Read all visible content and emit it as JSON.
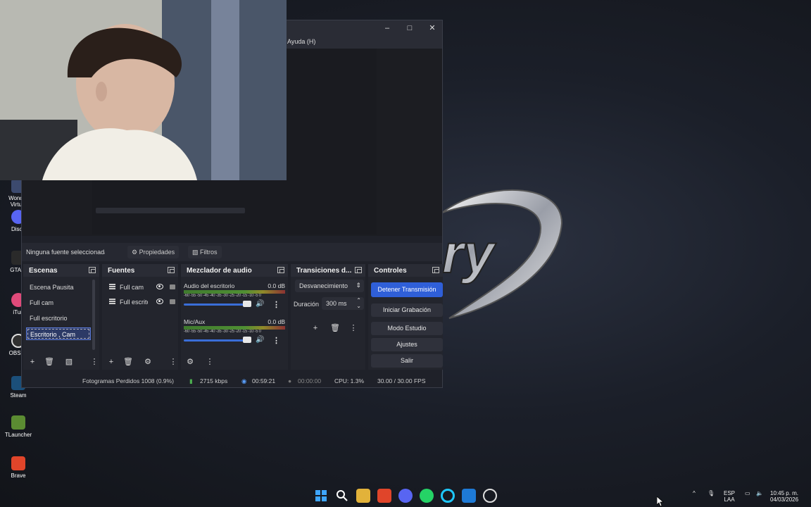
{
  "desktop": {
    "icons": [
      {
        "label": "Wonder\nVirtual",
        "icon": "app-icon"
      },
      {
        "label": "Disco",
        "icon": "discord-icon"
      },
      {
        "label": "GTA D",
        "icon": "gta-icon"
      },
      {
        "label": "iTun",
        "icon": "itunes-icon"
      },
      {
        "label": "OBS St",
        "icon": "obs-icon"
      },
      {
        "label": "Steam",
        "icon": "steam-icon"
      },
      {
        "label": "TLauncher",
        "icon": "tlauncher-icon"
      },
      {
        "label": "Brave",
        "icon": "brave-icon"
      }
    ]
  },
  "obs": {
    "menu_help": "Ayuda (H)",
    "no_source": "Ninguna fuente seleccionada",
    "properties_btn": "Propiedades",
    "filters_btn": "Filtros",
    "scenes": {
      "title": "Escenas",
      "items": [
        "Escena Pausita",
        "Full cam",
        "Full escritorio",
        "Escritorio , Cam"
      ],
      "selected_index": 3
    },
    "sources": {
      "title": "Fuentes",
      "items": [
        "Full cam",
        "Full escritorio"
      ]
    },
    "mixer": {
      "title": "Mezclador de audio",
      "scale": "-60 -55 -50 -45 -40 -35 -30 -25 -20 -15 -10 -5 0",
      "channels": [
        {
          "name": "Audio del escritorio",
          "db": "0.0 dB"
        },
        {
          "name": "Mic/Aux",
          "db": "0.0 dB"
        }
      ]
    },
    "transitions": {
      "title": "Transiciones d...",
      "selected": "Desvanecimiento",
      "duration_label": "Duración",
      "duration_value": "300 ms"
    },
    "controls": {
      "title": "Controles",
      "buttons": [
        "Detener Transmisión",
        "Iniciar Grabación",
        "Modo Estudio",
        "Ajustes",
        "Salir"
      ]
    },
    "status": {
      "dropped": "Fotogramas Perdidos 1008 (0.9%)",
      "bitrate": "2715 kbps",
      "stream_time": "00:59:21",
      "rec_time": "00:00:00",
      "cpu": "CPU: 1.3%",
      "fps": "30.00 / 30.00 FPS"
    }
  },
  "taskbar": {
    "lang_top": "ESP",
    "lang_bottom": "LAA",
    "time": "10:45 p. m.",
    "date": "04/03/2026"
  },
  "colors": {
    "accent": "#2f5fd8",
    "panel": "#23252d",
    "header": "#2a2c35"
  }
}
